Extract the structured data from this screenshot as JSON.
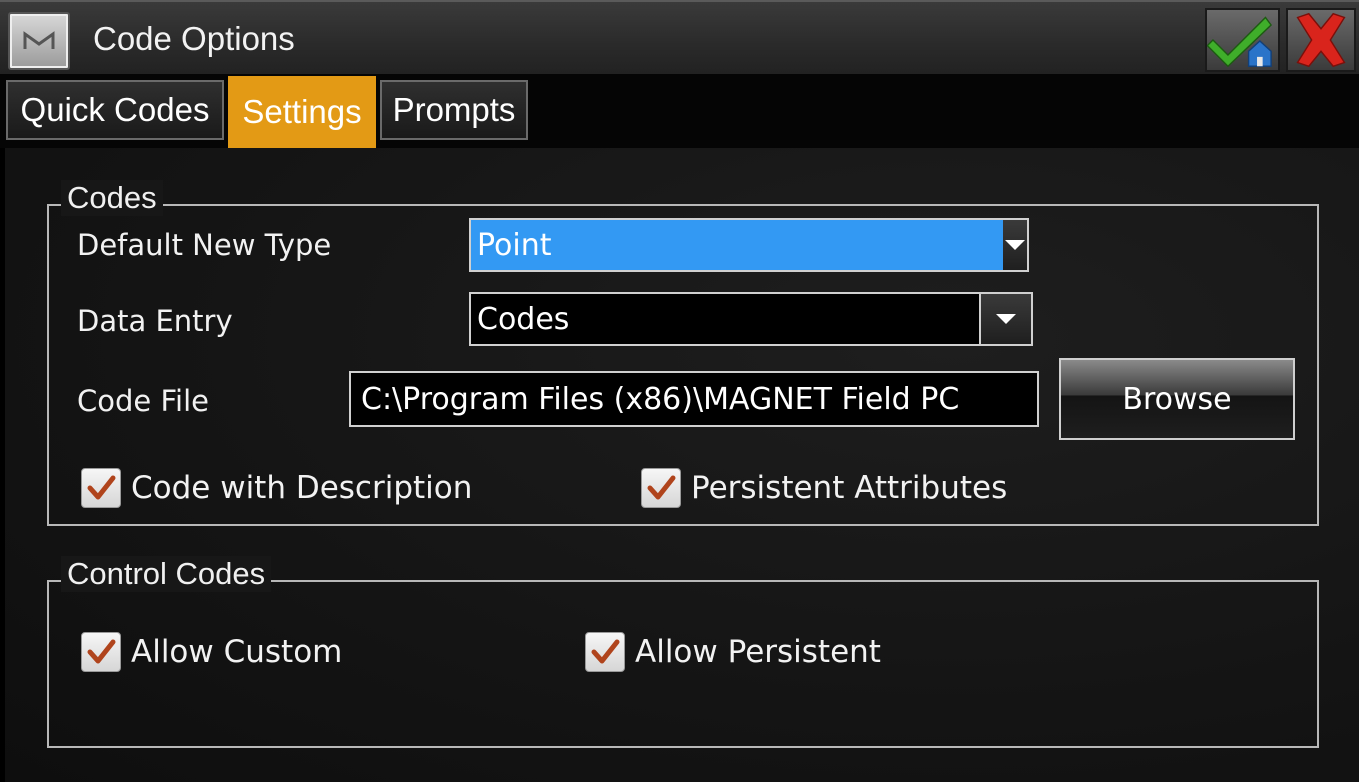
{
  "window": {
    "title": "Code Options",
    "logo_letter": "M",
    "ok_icon": "check-home-icon",
    "close_icon": "close-icon"
  },
  "tabs": [
    {
      "label": "Quick Codes",
      "active": false
    },
    {
      "label": "Settings",
      "active": true
    },
    {
      "label": "Prompts",
      "active": false
    }
  ],
  "codes_group": {
    "legend": "Codes",
    "default_new_type": {
      "label": "Default New Type",
      "value": "Point"
    },
    "data_entry": {
      "label": "Data Entry",
      "value": "Codes"
    },
    "code_file": {
      "label": "Code File",
      "value": "C:\\Program Files (x86)\\MAGNET Field PC",
      "browse_label": "Browse"
    },
    "code_with_description": {
      "label": "Code with Description",
      "checked": true
    },
    "persistent_attributes": {
      "label": "Persistent Attributes",
      "checked": true
    }
  },
  "control_group": {
    "legend": "Control Codes",
    "allow_custom": {
      "label": "Allow Custom",
      "checked": true
    },
    "allow_persistent": {
      "label": "Allow Persistent",
      "checked": true
    }
  },
  "colors": {
    "active_tab": "#e39a15",
    "selection": "#3399f3",
    "checkmark": "#b0441c"
  }
}
